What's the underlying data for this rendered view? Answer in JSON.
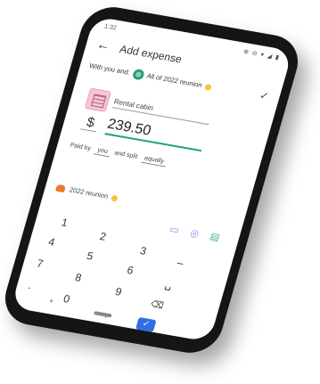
{
  "status": {
    "time": "1:32",
    "icons": "⊕ ⊖ ▾ ◢ ▮"
  },
  "appbar": {
    "back_icon": "←",
    "title": "Add expense",
    "save_icon": "✓"
  },
  "split_with": {
    "prefix": "With you and:",
    "group_name": "All of 2022 reunion"
  },
  "expense": {
    "description": "Rental cabin",
    "currency": "$",
    "amount": "239.50"
  },
  "paid": {
    "paid_by_label": "Paid by",
    "payer": "you",
    "split_label": "and split",
    "split_mode": "equally"
  },
  "group": {
    "name": "2022 reunion"
  },
  "tools": {
    "calendar_icon": "▭",
    "camera_icon": "◎",
    "receipt_icon": "▤"
  },
  "keypad": {
    "keys": [
      "1",
      "2",
      "3",
      "–",
      "4",
      "5",
      "6",
      "␣",
      "7",
      "8",
      "9",
      "⌫",
      ".",
      "0",
      ",",
      "✓"
    ]
  },
  "colors": {
    "accent_green": "#1aa37a",
    "done_blue": "#2f6fe3",
    "category_pink": "#f4c7d3",
    "group_orange": "#e87a2a"
  }
}
